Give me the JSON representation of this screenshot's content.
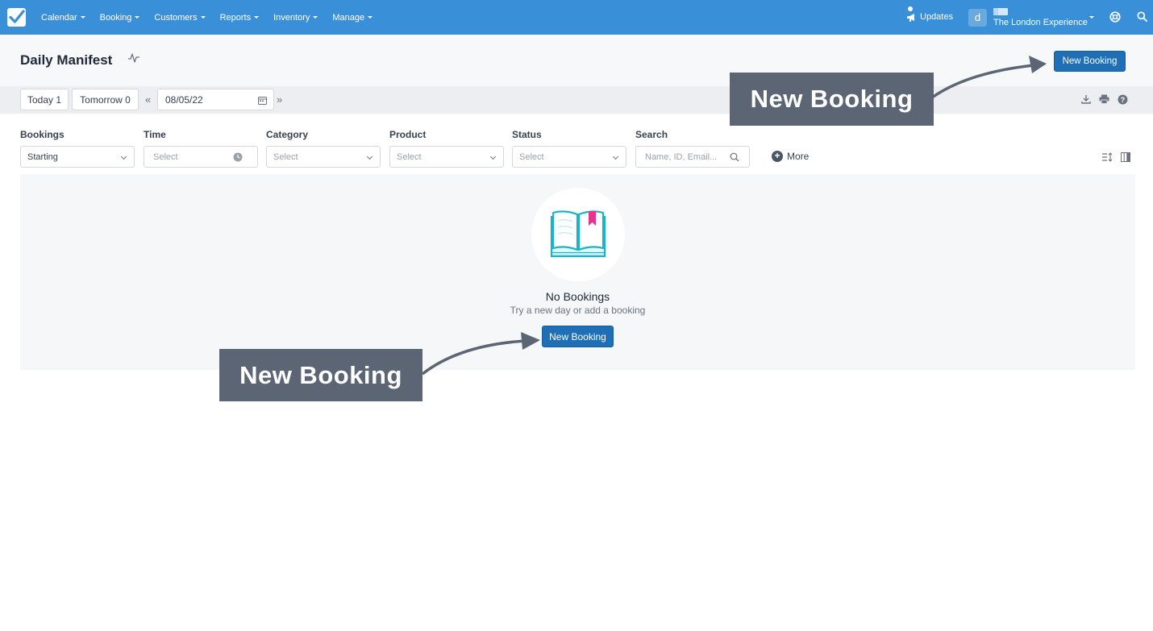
{
  "topbar": {
    "nav": [
      {
        "label": "Calendar"
      },
      {
        "label": "Booking"
      },
      {
        "label": "Customers"
      },
      {
        "label": "Reports"
      },
      {
        "label": "Inventory"
      },
      {
        "label": "Manage"
      }
    ],
    "updates_label": "Updates",
    "avatar_letter": "d",
    "account_name": "The London Experience",
    "colors": {
      "bar": "#3a8fd9",
      "primary_button": "#1f6fb6"
    }
  },
  "header": {
    "title": "Daily Manifest",
    "new_booking_label": "New Booking"
  },
  "toolbar": {
    "today_label": "Today 1",
    "tomorrow_label": "Tomorrow 0",
    "date_value": "08/05/22",
    "prev_icon": "double-chevron-left-icon",
    "next_icon": "double-chevron-right-icon"
  },
  "filters": {
    "bookings": {
      "label": "Bookings",
      "value": "Starting"
    },
    "time": {
      "label": "Time",
      "placeholder": "Select"
    },
    "category": {
      "label": "Category",
      "placeholder": "Select"
    },
    "product": {
      "label": "Product",
      "placeholder": "Select"
    },
    "status": {
      "label": "Status",
      "placeholder": "Select"
    },
    "search": {
      "label": "Search",
      "placeholder": "Name, ID, Email..."
    },
    "more_label": "More"
  },
  "empty_state": {
    "title": "No Bookings",
    "subtitle": "Try a new day or add a booking",
    "button_label": "New Booking",
    "icon": "open-book-icon"
  },
  "annotations": {
    "top_callout": "New Booking",
    "bottom_callout": "New Booking"
  }
}
